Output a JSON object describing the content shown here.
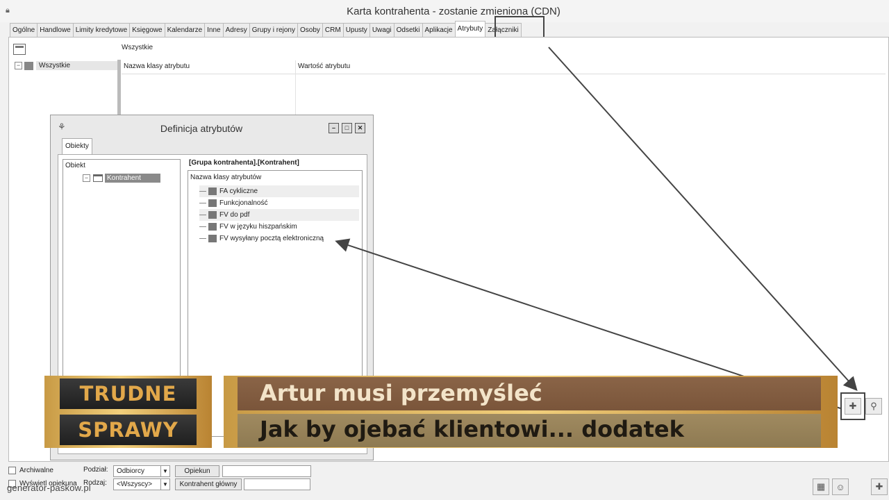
{
  "window": {
    "title": "Karta kontrahenta - zostanie zmieniona (CDN)",
    "tabs": [
      {
        "label": "Ogólne",
        "active": false
      },
      {
        "label": "Handlowe",
        "active": false
      },
      {
        "label": "Limity kredytowe",
        "active": false
      },
      {
        "label": "Księgowe",
        "active": false
      },
      {
        "label": "Kalendarze",
        "active": false
      },
      {
        "label": "Inne",
        "active": false
      },
      {
        "label": "Adresy",
        "active": false
      },
      {
        "label": "Grupy i rejony",
        "active": false
      },
      {
        "label": "Osoby",
        "active": false
      },
      {
        "label": "CRM",
        "active": false
      },
      {
        "label": "Upusty",
        "active": false
      },
      {
        "label": "Uwagi",
        "active": false
      },
      {
        "label": "Odsetki",
        "active": false
      },
      {
        "label": "Aplikacje",
        "active": false
      },
      {
        "label": "Atrybuty",
        "active": true
      },
      {
        "label": "Załączniki",
        "active": false
      }
    ]
  },
  "main": {
    "filter_label": "Wszystkie",
    "tree_root": "Wszystkie",
    "columns": [
      "Nazwa klasy atrybutu",
      "Wartość atrybutu"
    ]
  },
  "bottom": {
    "archiwalne": "Archiwalne",
    "wyswietl": "Wyświetl opiekuna",
    "podzial_label": "Podział:",
    "podzial_value": "Odbiorcy",
    "opiekun_button": "Opiekun",
    "rodzaj_label": "Rodzaj:",
    "rodzaj_value": "<Wszyscy>",
    "kontrahent_glowny_button": "Kontrahent główny"
  },
  "dialog": {
    "title": "Definicja atrybutów",
    "tab": "Obiekty",
    "object_header": "Obiekt",
    "object_node": "Kontrahent",
    "group_path": "[Grupa kontrahenta].[Kontrahent]",
    "attr_header": "Nazwa klasy atrybutów",
    "attributes": [
      "FA cykliczne",
      "Funkcjonalność",
      "FV do pdf",
      "FV w języku hiszpańskim",
      "FV wysyłany pocztą elektroniczną"
    ]
  },
  "banner": {
    "badge_top": "TRUDNE",
    "badge_bottom": "SPRAWY",
    "line1": "Artur musi przemyśleć",
    "line2": "Jak by ojebać klientowi... dodatek"
  },
  "watermark": "generator-paskow.pl",
  "icons": [
    "lock-icon",
    "window-icon",
    "tree-icon",
    "plus-icon",
    "search-icon",
    "minimize-icon",
    "maximize-icon",
    "close-icon"
  ],
  "colors": {
    "banner_gold": "#e1b865",
    "banner_brown": "#7a553a",
    "badge_text": "#e2a84a"
  }
}
